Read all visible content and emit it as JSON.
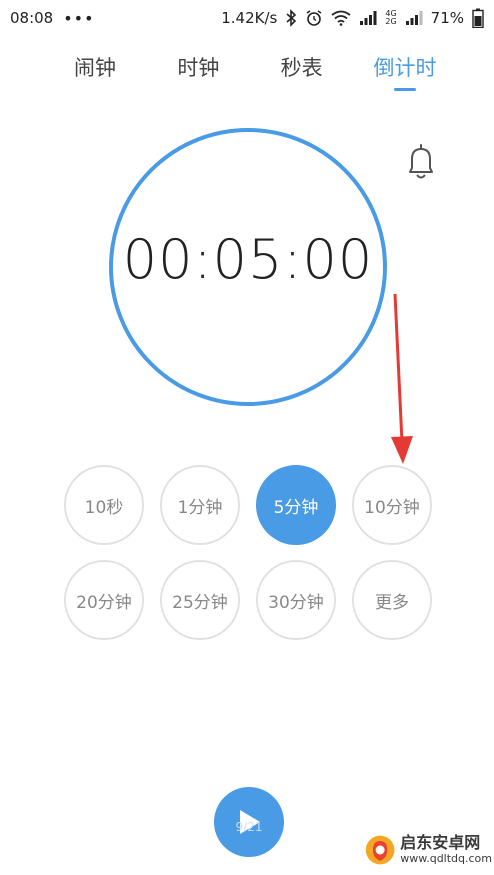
{
  "status_bar": {
    "time": "08:08",
    "dots": "•••",
    "speed": "1.42K/s",
    "net_top": "4G",
    "net_bottom": "2G",
    "battery": "71%"
  },
  "tabs": [
    {
      "label": "闹钟",
      "active": false
    },
    {
      "label": "时钟",
      "active": false
    },
    {
      "label": "秒表",
      "active": false
    },
    {
      "label": "倒计时",
      "active": true
    }
  ],
  "timer": {
    "display": "00:05:00"
  },
  "presets": [
    {
      "label": "10秒",
      "selected": false
    },
    {
      "label": "1分钟",
      "selected": false
    },
    {
      "label": "5分钟",
      "selected": true
    },
    {
      "label": "10分钟",
      "selected": false
    },
    {
      "label": "20分钟",
      "selected": false
    },
    {
      "label": "25分钟",
      "selected": false
    },
    {
      "label": "30分钟",
      "selected": false
    },
    {
      "label": "更多",
      "selected": false
    }
  ],
  "play": {
    "caption": "9/21"
  },
  "watermark": {
    "title": "启东安卓网",
    "url": "www.qdltdq.com"
  },
  "colors": {
    "accent": "#4a9be5",
    "arrow": "#e53935",
    "preset_border": "#e1e1e1"
  }
}
